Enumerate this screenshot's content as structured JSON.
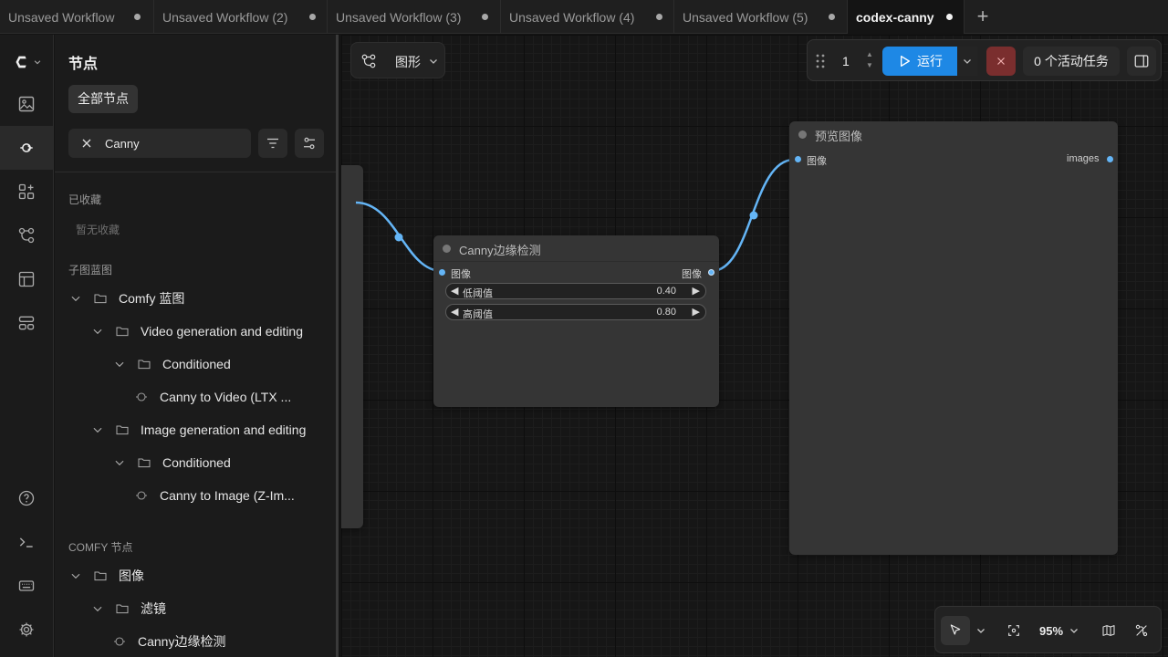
{
  "tabs": [
    {
      "label": "Unsaved Workflow",
      "active": false
    },
    {
      "label": "Unsaved Workflow (2)",
      "active": false
    },
    {
      "label": "Unsaved Workflow (3)",
      "active": false
    },
    {
      "label": "Unsaved Workflow (4)",
      "active": false
    },
    {
      "label": "Unsaved Workflow (5)",
      "active": false
    },
    {
      "label": "codex-canny",
      "active": true
    }
  ],
  "sidebar": {
    "title": "节点",
    "all_nodes_label": "全部节点",
    "search": {
      "value": "Canny",
      "placeholder": ""
    },
    "favorites": {
      "label": "已收藏",
      "empty_text": "暂无收藏"
    },
    "blueprints": {
      "label": "子图蓝图",
      "root": "Comfy 蓝图",
      "video_group": "Video generation and editing",
      "video_sub": "Conditioned",
      "video_item": "Canny to Video (LTX ...",
      "image_group": "Image generation and editing",
      "image_sub": "Conditioned",
      "image_item": "Canny to Image (Z-Im..."
    },
    "comfy_nodes": {
      "label": "COMFY 节点",
      "root": "图像",
      "sub": "滤镜",
      "item": "Canny边缘检测"
    }
  },
  "graph_mode": {
    "label": "图形",
    "icon": "graph-icon"
  },
  "run_toolbar": {
    "batch_count": "1",
    "run_label": "运行",
    "active_tasks_label": "0 个活动任务"
  },
  "nodes": {
    "canny": {
      "title": "Canny边缘检测",
      "input_label": "图像",
      "output_label": "图像",
      "low_threshold_label": "低阈值",
      "low_threshold_value": "0.40",
      "high_threshold_label": "高阈值",
      "high_threshold_value": "0.80"
    },
    "preview": {
      "title": "预览图像",
      "input_label": "图像",
      "output_label": "images"
    }
  },
  "view_controls": {
    "zoom": "95%"
  },
  "colors": {
    "accent": "#1e88e5",
    "link": "#64b5f6",
    "cancel": "#7a2e2e"
  }
}
